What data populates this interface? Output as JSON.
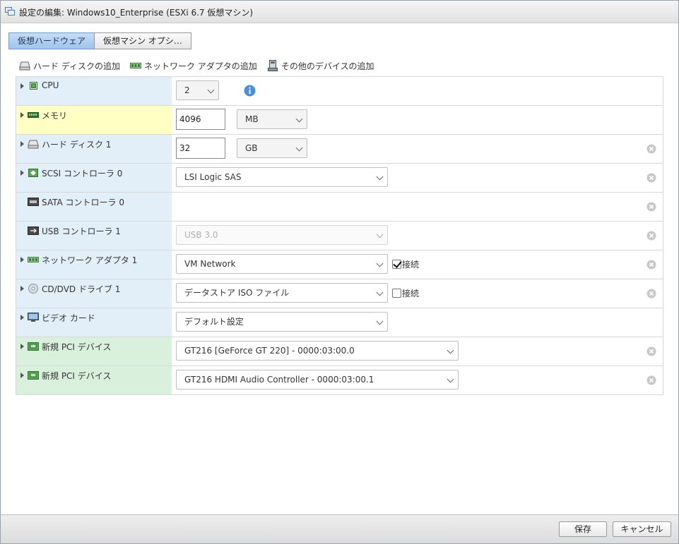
{
  "window": {
    "title": "設定の編集: Windows10_Enterprise (ESXi 6.7 仮想マシン)"
  },
  "tabs": [
    {
      "label": "仮想ハードウェア",
      "active": true
    },
    {
      "label": "仮想マシン オプシ…",
      "active": false
    }
  ],
  "toolbar": {
    "add_disk": "ハード ディスクの追加",
    "add_network": "ネットワーク アダプタの追加",
    "add_other": "その他のデバイスの追加"
  },
  "rows": {
    "cpu": {
      "label": "CPU",
      "value": "2"
    },
    "memory": {
      "label": "メモリ",
      "value": "4096",
      "unit": "MB"
    },
    "disk": {
      "label": "ハード ディスク 1",
      "value": "32",
      "unit": "GB"
    },
    "scsi": {
      "label": "SCSI コントローラ 0",
      "value": "LSI Logic SAS"
    },
    "sata": {
      "label": "SATA コントローラ 0"
    },
    "usb": {
      "label": "USB コントローラ 1",
      "value": "USB 3.0"
    },
    "network": {
      "label": "ネットワーク アダプタ 1",
      "value": "VM Network",
      "connect_label": "接続",
      "connected": true
    },
    "cddvd": {
      "label": "CD/DVD ドライブ 1",
      "value": "データストア ISO ファイル",
      "connect_label": "接続",
      "connected": false
    },
    "video": {
      "label": "ビデオ カード",
      "value": "デフォルト設定"
    },
    "pci1": {
      "label": "新規 PCI デバイス",
      "value": "GT216 [GeForce GT 220] - 0000:03:00.0"
    },
    "pci2": {
      "label": "新規 PCI デバイス",
      "value": "GT216 HDMI Audio Controller - 0000:03:00.1"
    }
  },
  "footer": {
    "save": "保存",
    "cancel": "キャンセル"
  },
  "colors": {
    "accent": "#4a90d9",
    "row_default": "#e2eef8",
    "row_modified": "#ffffc4",
    "row_new": "#d9f0dc"
  }
}
